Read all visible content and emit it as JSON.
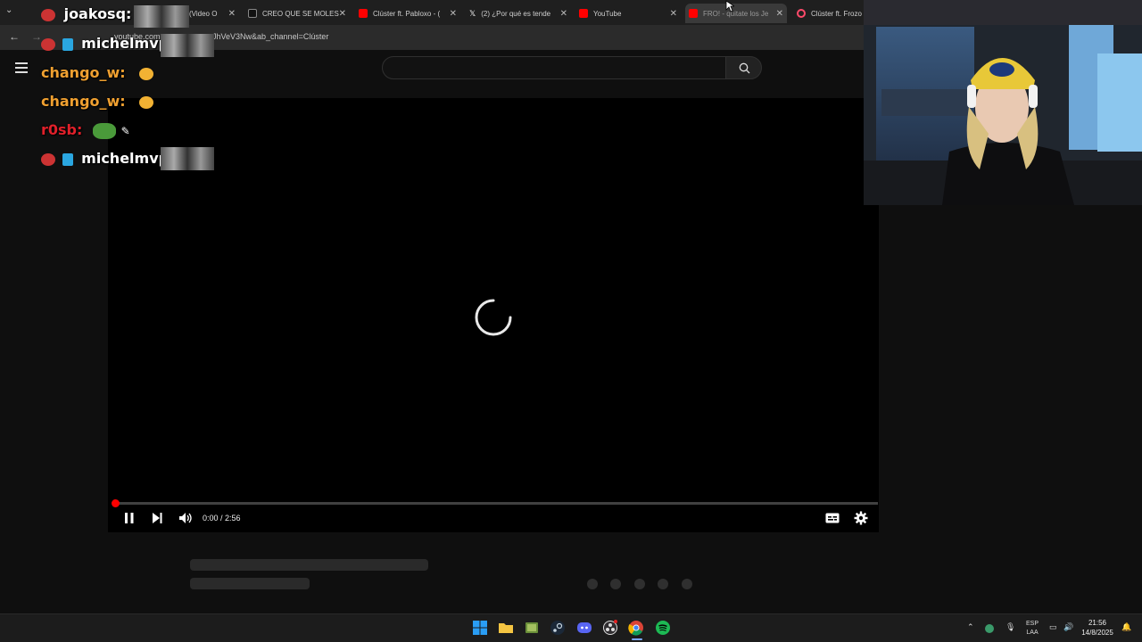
{
  "browser": {
    "tabs": [
      {
        "title": "(Video O",
        "icon": "youtube-icon",
        "color": "#ff0000"
      },
      {
        "title": "CREO QUE SE MOLES",
        "icon": "tiktok-icon",
        "color": "#ffffff"
      },
      {
        "title": "Clúster ft. Pabloxo - (",
        "icon": "youtube-icon",
        "color": "#ff0000"
      },
      {
        "title": "(2) ¿Por qué es tende",
        "icon": "x-icon",
        "color": "#ffffff"
      },
      {
        "title": "YouTube",
        "icon": "youtube-icon",
        "color": "#ff0000"
      },
      {
        "title": "FRO! - quitate los Je",
        "icon": "youtube-icon",
        "color": "#ff0000"
      },
      {
        "title": "Clúster ft. Frozo",
        "icon": "app-icon",
        "color": "#ff4a6a"
      }
    ],
    "url_prefix": "youtube.com",
    "url_suffix": "JhVeV3Nw&ab_channel=Clúster"
  },
  "player": {
    "time": "0:00 / 2:56",
    "progress_fraction": 0.0
  },
  "chat": [
    {
      "user": "joakosq:",
      "color": "#ffffff"
    },
    {
      "user": "michelmvp:",
      "color": "#ffffff"
    },
    {
      "user": "chango_w:",
      "color": "#f0a030"
    },
    {
      "user": "chango_w:",
      "color": "#f0a030"
    },
    {
      "user": "r0sb:",
      "color": "#e0202a"
    },
    {
      "user": "michelmvp:",
      "color": "#ffffff"
    }
  ],
  "tray": {
    "lang_top": "ESP",
    "lang_bottom": "LAA",
    "time": "21:56",
    "date": "14/8/2025"
  },
  "colors": {
    "accent_red": "#ff0000",
    "background": "#0f0f0f"
  }
}
